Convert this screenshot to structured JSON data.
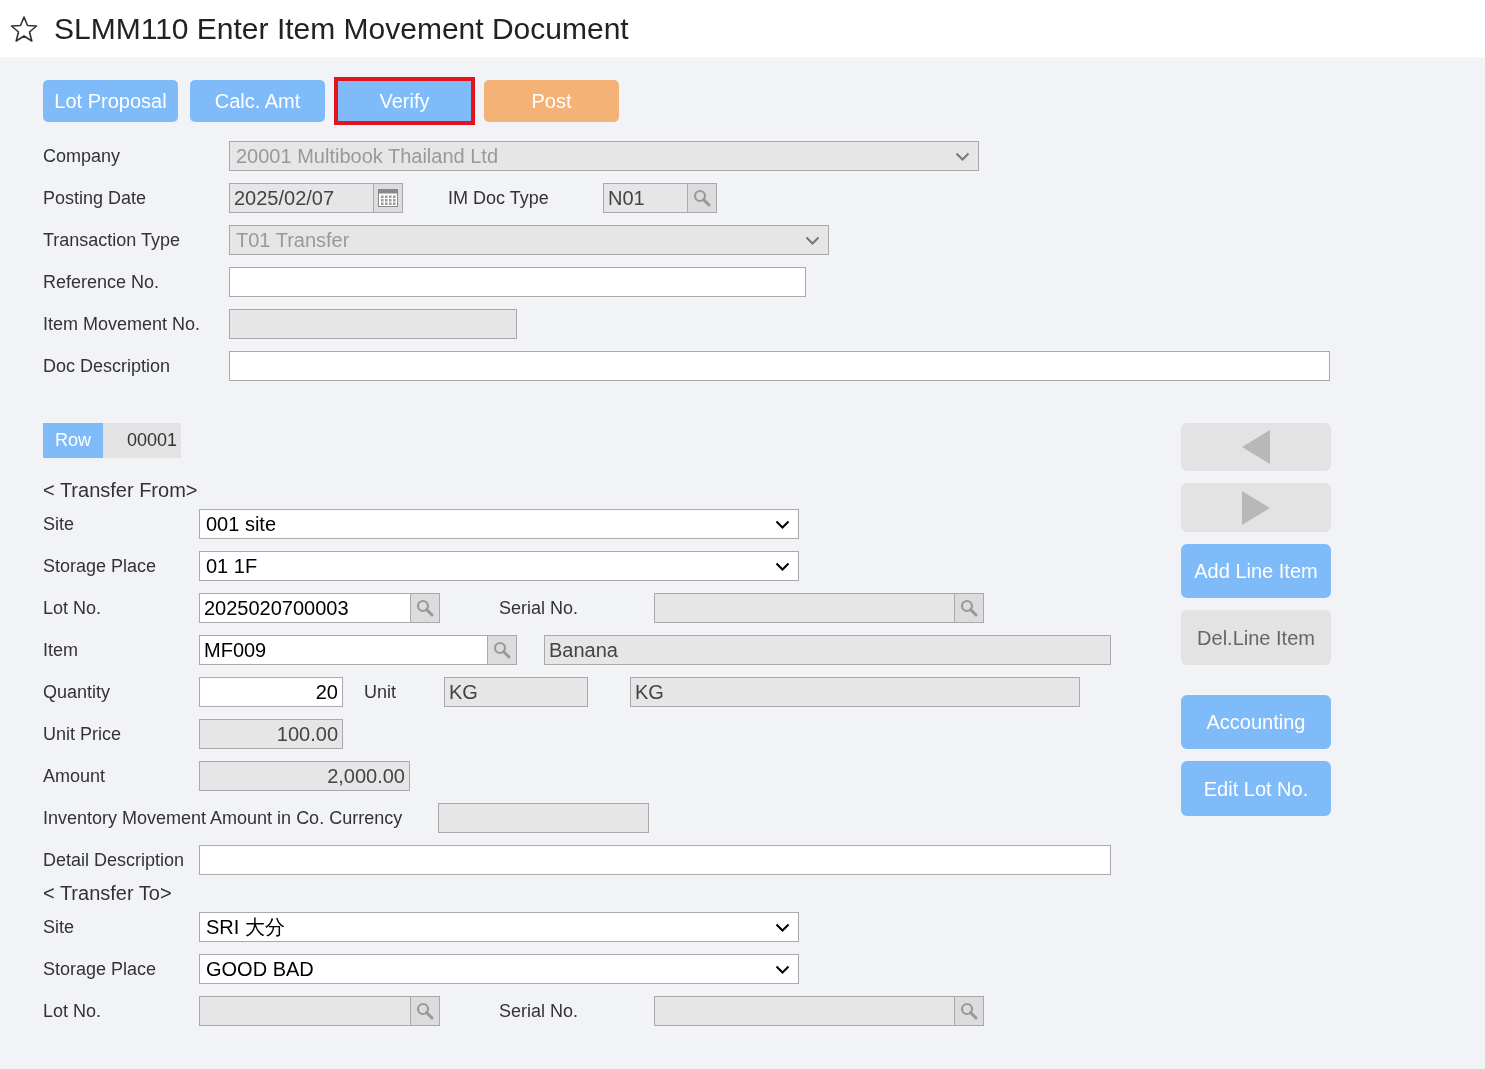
{
  "page": {
    "title": "SLMM110 Enter Item Movement Document"
  },
  "actions": [
    {
      "label": "Lot Proposal",
      "kind": "primary",
      "highlighted": false
    },
    {
      "label": "Calc. Amt",
      "kind": "primary",
      "highlighted": false
    },
    {
      "label": "Verify",
      "kind": "primary",
      "highlighted": true
    },
    {
      "label": "Post",
      "kind": "accent",
      "highlighted": false
    }
  ],
  "header": {
    "company": {
      "label": "Company",
      "value": "20001 Multibook Thailand Ltd",
      "disabled": true
    },
    "posting_date": {
      "label": "Posting Date",
      "value": "2025/02/07",
      "disabled": true
    },
    "im_doc_type": {
      "label": "IM Doc Type",
      "value": "N01",
      "disabled": true
    },
    "transaction_type": {
      "label": "Transaction Type",
      "value": "T01 Transfer",
      "disabled": true
    },
    "reference_no": {
      "label": "Reference No.",
      "disabled": false
    },
    "item_movement_no": {
      "label": "Item Movement No.",
      "disabled": true
    },
    "doc_description": {
      "label": "Doc Description",
      "disabled": false
    }
  },
  "row": {
    "label": "Row",
    "value": "00001"
  },
  "transfer_from": {
    "heading": "< Transfer From>",
    "site": {
      "label": "Site",
      "value": "001 site",
      "disabled": false
    },
    "storage_place": {
      "label": "Storage Place",
      "value": "01 1F",
      "disabled": false
    },
    "lot_no": {
      "label": "Lot No.",
      "value": "2025020700003",
      "disabled": false
    },
    "serial_no": {
      "label": "Serial No.",
      "disabled": true
    },
    "item": {
      "label": "Item",
      "value": "MF009",
      "disabled": false
    },
    "item_name": {
      "value": "Banana",
      "disabled": true
    },
    "quantity": {
      "label": "Quantity",
      "value": "20",
      "disabled": false
    },
    "unit": {
      "label": "Unit",
      "value": "KG",
      "disabled": true
    },
    "unit_name": {
      "value": "KG",
      "disabled": true
    },
    "unit_price": {
      "label": "Unit Price",
      "value": "100.00",
      "disabled": true
    },
    "amount": {
      "label": "Amount",
      "value": "2,000.00",
      "disabled": true
    },
    "co_currency_amount": {
      "label": "Inventory Movement Amount in Co. Currency",
      "disabled": true
    },
    "detail_description": {
      "label": "Detail Description",
      "disabled": false
    }
  },
  "transfer_to": {
    "heading": "< Transfer To>",
    "site": {
      "label": "Site",
      "value": "SRI 大分",
      "disabled": false
    },
    "storage_place": {
      "label": "Storage Place",
      "value": "GOOD BAD",
      "disabled": false
    },
    "lot_no": {
      "label": "Lot No.",
      "disabled": true
    },
    "serial_no": {
      "label": "Serial No.",
      "disabled": true
    }
  },
  "side_buttons": [
    {
      "kind": "previous",
      "disabled": true
    },
    {
      "kind": "next",
      "disabled": true
    },
    {
      "kind": "text",
      "label": "Add Line Item",
      "disabled": false
    },
    {
      "kind": "text",
      "label": "Del.Line Item",
      "disabled": true
    },
    {
      "kind": "text",
      "label": "Accounting",
      "disabled": false
    },
    {
      "kind": "text",
      "label": "Edit Lot No.",
      "disabled": false
    }
  ]
}
